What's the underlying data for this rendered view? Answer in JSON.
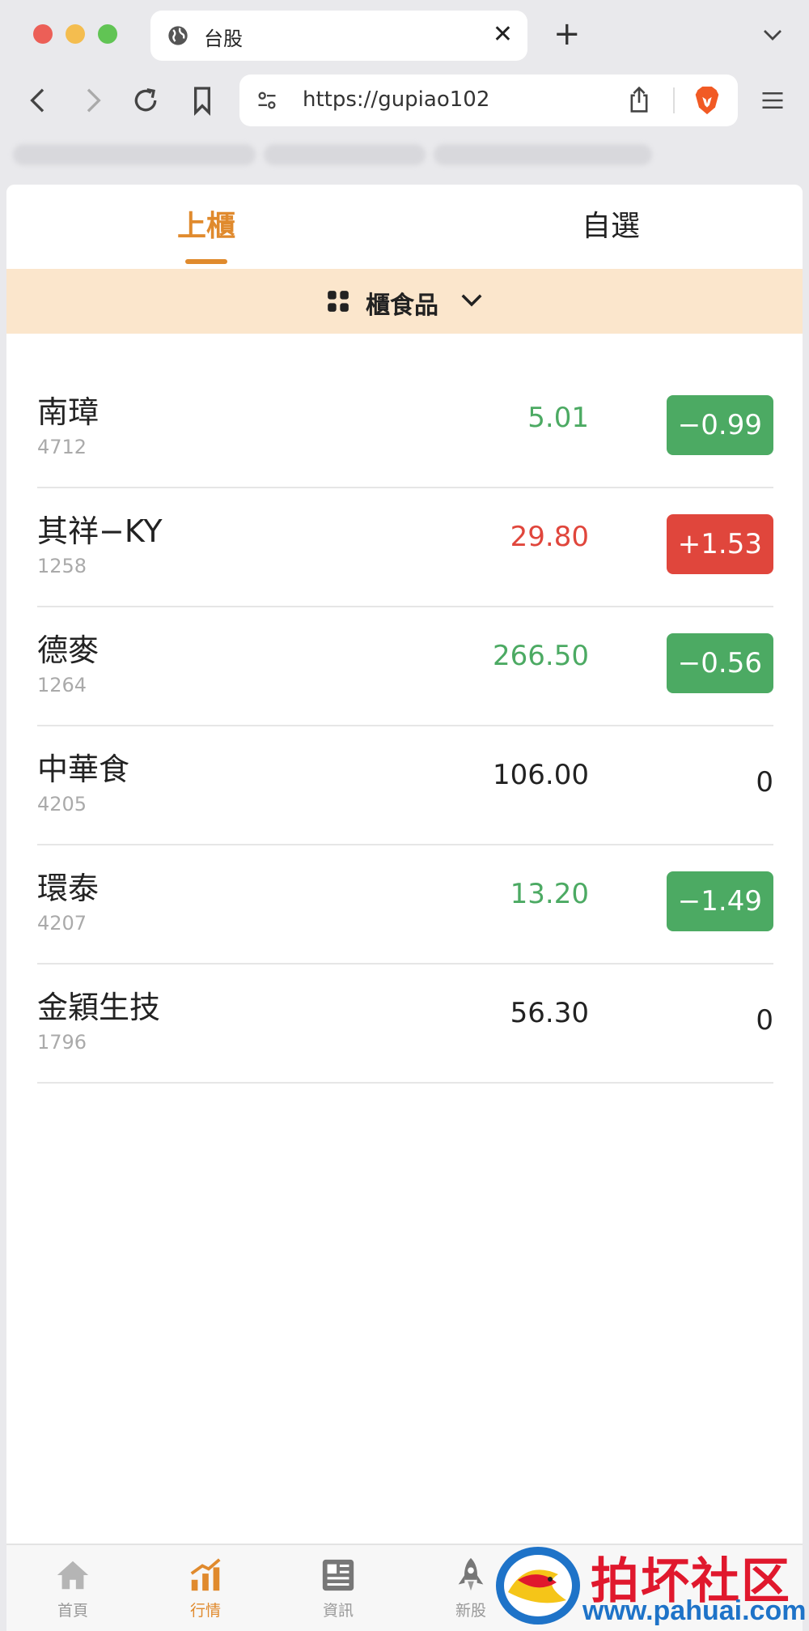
{
  "browser": {
    "tab_title": "台股",
    "tab_close": "✕",
    "new_tab": "+",
    "url": "https://gupiao102"
  },
  "top_tabs": [
    {
      "label": "上櫃",
      "active": true
    },
    {
      "label": "自選",
      "active": false
    }
  ],
  "category": {
    "label": "櫃食品"
  },
  "colors": {
    "up": "#e0463c",
    "down": "#4caa63",
    "flat": "#222222",
    "accent": "#e08a2d",
    "category_bg": "#fbe6cc"
  },
  "stocks": [
    {
      "name": "南璋",
      "code": "4712",
      "price": "5.01",
      "change": "−0.99",
      "direction": "down"
    },
    {
      "name": "其祥−KY",
      "code": "1258",
      "price": "29.80",
      "change": "+1.53",
      "direction": "up"
    },
    {
      "name": "德麥",
      "code": "1264",
      "price": "266.50",
      "change": "−0.56",
      "direction": "down"
    },
    {
      "name": "中華食",
      "code": "4205",
      "price": "106.00",
      "change": "0",
      "direction": "flat"
    },
    {
      "name": "環泰",
      "code": "4207",
      "price": "13.20",
      "change": "−1.49",
      "direction": "down"
    },
    {
      "name": "金穎生技",
      "code": "1796",
      "price": "56.30",
      "change": "0",
      "direction": "flat"
    }
  ],
  "bottom_nav": [
    {
      "label": "首頁",
      "icon": "home-icon",
      "active": false
    },
    {
      "label": "行情",
      "icon": "chart-icon",
      "active": true
    },
    {
      "label": "資訊",
      "icon": "news-icon",
      "active": false
    },
    {
      "label": "新股",
      "icon": "rocket-icon",
      "active": false
    }
  ],
  "watermark": {
    "text": "拍坏社区",
    "url": "www.pahuai.com"
  }
}
